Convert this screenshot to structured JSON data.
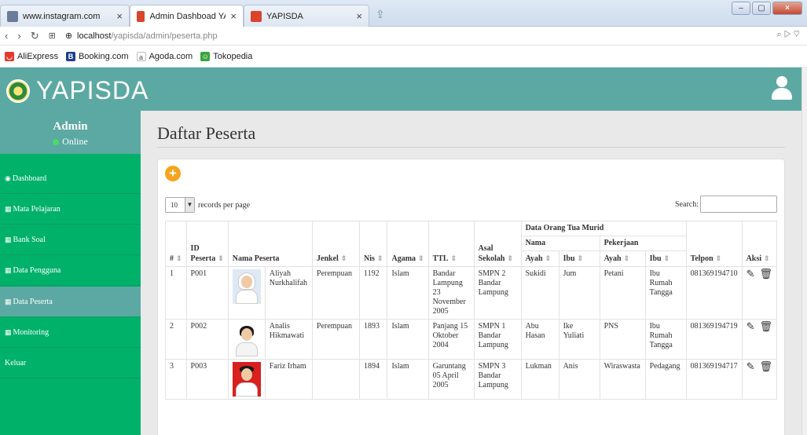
{
  "browser": {
    "tabs": [
      {
        "title": "www.instagram.com",
        "active": false
      },
      {
        "title": "Admin Dashboad YAPISD/",
        "active": true
      },
      {
        "title": "YAPISDA",
        "active": false
      }
    ],
    "url_host": "localhost",
    "url_path": "/yapisda/admin/peserta.php",
    "bookmarks": [
      "AliExpress",
      "Booking.com",
      "Agoda.com",
      "Tokopedia"
    ]
  },
  "header": {
    "brand": "YAPISDA"
  },
  "sidebar": {
    "user_name": "Admin",
    "user_status": "Online",
    "items": [
      {
        "label": "Dashboard",
        "icon": "dashboard-icon"
      },
      {
        "label": "Mata Pelajaran",
        "icon": "table-icon"
      },
      {
        "label": "Bank Soal",
        "icon": "table-icon"
      },
      {
        "label": "Data Pengguna",
        "icon": "table-icon"
      },
      {
        "label": "Data Peserta",
        "icon": "table-icon",
        "active": true
      },
      {
        "label": "Monitoring",
        "icon": "table-icon"
      },
      {
        "label": "Keluar",
        "icon": ""
      }
    ]
  },
  "main": {
    "title": "Daftar Peserta",
    "records_value": "10",
    "records_label": "records per page",
    "search_label": "Search:",
    "columns": {
      "no": "#",
      "id": "ID Peserta",
      "nama": "Nama Peserta",
      "jenkel": "Jenkel",
      "nis": "Nis",
      "agama": "Agama",
      "ttl": "TTL",
      "sekolah": "Asal Sekolah",
      "ortu": "Data Orang Tua Murid",
      "ortu_nama": "Nama",
      "ortu_kerja": "Pekerjaan",
      "ayah": "Ayah",
      "ibu": "Ibu",
      "telpon": "Telpon",
      "aksi": "Aksi"
    },
    "rows": [
      {
        "no": "1",
        "id": "P001",
        "nama": "Aliyah Nurkhalifah",
        "jenkel": "Perempuan",
        "nis": "1192",
        "agama": "Islam",
        "ttl": "Bandar Lampung 23 November 2005",
        "sekolah": "SMPN 2 Bandar Lampung",
        "ayah": "Sukidi",
        "ibu": "Jum",
        "kerja_ayah": "Petani",
        "kerja_ibu": "Ibu Rumah Tangga",
        "telpon": "081369194710"
      },
      {
        "no": "2",
        "id": "P002",
        "nama": "Analis Hikmawati",
        "jenkel": "Perempuan",
        "nis": "1893",
        "agama": "Islam",
        "ttl": "Panjang 15 Oktober 2004",
        "sekolah": "SMPN 1 Bandar Lampung",
        "ayah": "Abu Hasan",
        "ibu": "Ike Yuliati",
        "kerja_ayah": "PNS",
        "kerja_ibu": "Ibu Rumah Tangga",
        "telpon": "081369194719"
      },
      {
        "no": "3",
        "id": "P003",
        "nama": "Fariz Irham",
        "jenkel": "",
        "nis": "1894",
        "agama": "Islam",
        "ttl": "Garuntang 05 April 2005",
        "sekolah": "SMPN 3 Bandar Lampung",
        "ayah": "Lukman",
        "ibu": "Anis",
        "kerja_ayah": "Wiraswasta",
        "kerja_ibu": "Pedagang",
        "telpon": "081369194717"
      }
    ]
  }
}
